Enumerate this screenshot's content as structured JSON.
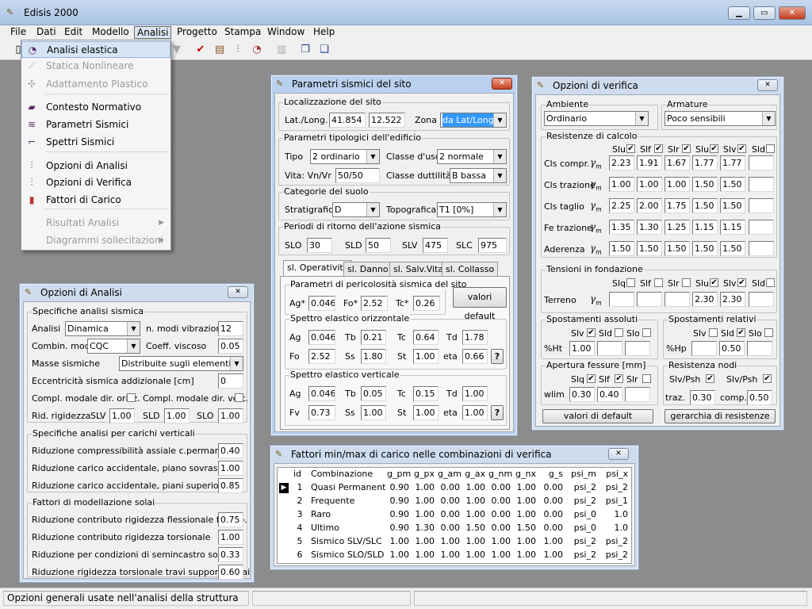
{
  "app": {
    "title": "Edisis 2000",
    "icon": "app-logo-icon"
  },
  "menubar": [
    "File",
    "Dati",
    "Edit",
    "Modello",
    "Analisi",
    "Progetto",
    "Stampa",
    "Window",
    "Help"
  ],
  "analisi_menu": {
    "items": [
      {
        "label": "Analisi elastica",
        "icon": "alarm-clock-icon",
        "disabled": false,
        "highlight": true
      },
      {
        "label": "Statica Nonlineare",
        "icon": "nonlinear-curve-icon",
        "disabled": true
      },
      {
        "label": "Adattamento Plastico",
        "icon": "plastic-icon",
        "disabled": true
      },
      {
        "label": "Contesto Normativo",
        "icon": "book-icon",
        "disabled": false
      },
      {
        "label": "Parametri Sismici",
        "icon": "seismograph-icon",
        "disabled": false
      },
      {
        "label": "Spettri Sismici",
        "icon": "spectrum-icon",
        "disabled": false
      },
      {
        "label": "Opzioni di Analisi",
        "icon": "options-icon",
        "disabled": false
      },
      {
        "label": "Opzioni di Verifica",
        "icon": "options-icon",
        "disabled": false
      },
      {
        "label": "Fattori di Carico",
        "icon": "bar-chart-icon",
        "disabled": false
      },
      {
        "label": "Risultati Analisi",
        "icon": "",
        "disabled": true,
        "submenu": true
      },
      {
        "label": "Diagrammi sollecitazioni",
        "icon": "",
        "disabled": true,
        "submenu": true
      }
    ]
  },
  "param_sismici": {
    "title": "Parametri sismici del sito",
    "loc": {
      "legend": "Localizzazione del sito",
      "latlong_label": "Lat./Long.",
      "lat": "41.854",
      "long": "12.522",
      "zona_label": "Zona",
      "zona": "da Lat/Long"
    },
    "tip": {
      "legend": "Parametri tipologici dell'edificio",
      "tipo_label": "Tipo",
      "tipo": "2 ordinario",
      "classe_uso_label": "Classe d'uso",
      "classe_uso": "2 normale",
      "vita_label": "Vita: Vn/Vr",
      "vita": "50/50",
      "classe_dutt_label": "Classe duttilità",
      "classe_dutt": "B bassa"
    },
    "suolo": {
      "legend": "Categorie del suolo",
      "strat_label": "Stratigrafica",
      "strat": "D",
      "topo_label": "Topografica",
      "topo": "T1  [0%]"
    },
    "periodi": {
      "legend": "Periodi di ritorno dell'azione sismica",
      "slo_label": "SLO",
      "slo": "30",
      "sld_label": "SLD",
      "sld": "50",
      "slv_label": "SLV",
      "slv": "475",
      "slc_label": "SLC",
      "slc": "975"
    },
    "tabs": [
      "sl. Operatività",
      "sl. Danno",
      "sl. Salv.Vita",
      "sl. Collasso"
    ],
    "peric": {
      "legend": "Parametri di pericolosità sismica del sito",
      "ag_label": "Ag*",
      "ag": "0.046",
      "fo_label": "Fo*",
      "fo": "2.52",
      "tc_label": "Tc*",
      "tc": "0.26",
      "default_btn": "valori default"
    },
    "orizz": {
      "legend": "Spettro elastico orizzontale",
      "ag": "0.046",
      "tb": "0.21",
      "tc": "0.64",
      "td": "1.78",
      "fo": "2.52",
      "ss": "1.80",
      "st": "1.00",
      "eta": "0.66"
    },
    "vert": {
      "legend": "Spettro elastico verticale",
      "ag": "0.046",
      "tb": "0.05",
      "tc": "0.15",
      "td": "1.00",
      "fv": "0.73",
      "ss": "1.00",
      "st": "1.00",
      "eta": "1.00"
    },
    "labels": {
      "ag": "Ag",
      "tb": "Tb",
      "tc": "Tc",
      "td": "Td",
      "fo": "Fo",
      "fv": "Fv",
      "ss": "Ss",
      "st": "St",
      "eta": "eta",
      "help": "?"
    }
  },
  "opz_verifica": {
    "title": "Opzioni di verifica",
    "ambiente_legend": "Ambiente",
    "ambiente": "Ordinario",
    "armature_legend": "Armature",
    "armature": "Poco sensibili",
    "resistenze_legend": "Resistenze di calcolo",
    "cols": [
      {
        "label": "Slu",
        "checked": true
      },
      {
        "label": "Slf",
        "checked": true
      },
      {
        "label": "Slr",
        "checked": true
      },
      {
        "label": "Slu",
        "checked": true
      },
      {
        "label": "Slv",
        "checked": true
      },
      {
        "label": "Sld",
        "checked": false
      }
    ],
    "gamma": "γ",
    "gamma_sub": "m",
    "rows": [
      {
        "label": "Cls compr.",
        "values": [
          "2.23",
          "1.91",
          "1.67",
          "1.77",
          "1.77",
          ""
        ]
      },
      {
        "label": "Cls trazione",
        "values": [
          "1.00",
          "1.00",
          "1.00",
          "1.50",
          "1.50",
          ""
        ]
      },
      {
        "label": "Cls taglio",
        "values": [
          "2.25",
          "2.00",
          "1.75",
          "1.50",
          "1.50",
          ""
        ]
      },
      {
        "label": "Fe trazione",
        "values": [
          "1.35",
          "1.30",
          "1.25",
          "1.15",
          "1.15",
          ""
        ]
      },
      {
        "label": "Aderenza",
        "values": [
          "1.50",
          "1.50",
          "1.50",
          "1.50",
          "1.50",
          ""
        ]
      }
    ],
    "tensioni_legend": "Tensioni in fondazione",
    "tens_cols": [
      {
        "label": "Slq",
        "checked": false
      },
      {
        "label": "Slf",
        "checked": false
      },
      {
        "label": "Slr",
        "checked": false
      },
      {
        "label": "Slu",
        "checked": true
      },
      {
        "label": "Slv",
        "checked": true
      },
      {
        "label": "Sld",
        "checked": false
      }
    ],
    "terreno_label": "Terreno",
    "terreno_values": [
      "",
      "",
      "",
      "2.30",
      "2.30",
      ""
    ],
    "spost_ass_legend": "Spostamenti assoluti",
    "spost_ass_cols": [
      {
        "label": "Slv",
        "checked": true
      },
      {
        "label": "Sld",
        "checked": false
      },
      {
        "label": "Slo",
        "checked": false
      }
    ],
    "ht_label": "%Ht",
    "ht_values": [
      "1.00",
      "",
      ""
    ],
    "spost_rel_legend": "Spostamenti relativi",
    "spost_rel_cols": [
      {
        "label": "Slv",
        "checked": false
      },
      {
        "label": "Sld",
        "checked": true
      },
      {
        "label": "Slo",
        "checked": false
      }
    ],
    "hp_label": "%Hp",
    "hp_values": [
      "",
      "0.50",
      ""
    ],
    "fessure_legend": "Apertura fessure [mm]",
    "fess_cols": [
      {
        "label": "Slq",
        "checked": true
      },
      {
        "label": "Slf",
        "checked": true
      },
      {
        "label": "Slr",
        "checked": false
      }
    ],
    "wlim_label": "wlim",
    "wlim_values": [
      "0.30",
      "0.40",
      ""
    ],
    "nodi_legend": "Resistenza nodi",
    "nodi_cols": [
      {
        "label": "Slv/Psh",
        "checked": true
      },
      {
        "label": "Slv/Psh",
        "checked": true
      }
    ],
    "traz_label": "traz.",
    "traz": "0.30",
    "comp_label": "comp.",
    "comp": "0.50",
    "btn_default": "valori di default",
    "btn_gerarchia": "gerarchia di resistenze"
  },
  "opz_analisi": {
    "title": "Opzioni di Analisi",
    "sismica_legend": "Specifiche analisi sismica",
    "analisi_label": "Analisi",
    "analisi": "Dinamica",
    "nmodi_label": "n. modi vibrazione",
    "nmodi": "12",
    "combin_label": "Combin. modi",
    "combin": "CQC",
    "viscoso_label": "Coeff. viscoso",
    "viscoso": "0.05",
    "masse_label": "Masse sismiche",
    "masse": "Distribuite sugli elementi",
    "eccentr_label": "Eccentricità sismica addizionale [cm]",
    "eccentr": "0",
    "compl_orizz_label": "Compl. modale dir. orizz.",
    "compl_vert_label": "Compl. modale dir. vert.",
    "rid_label": "Rid. rigidezza",
    "slv_label": "SLV",
    "slv": "1.00",
    "sld_label": "SLD",
    "sld": "1.00",
    "slo_label": "SLO",
    "slo": "1.00",
    "verticali_legend": "Specifiche analisi per carichi verticali",
    "vert_rows": [
      {
        "label": "Riduzione compressibilità assiale c.permanente",
        "value": "0.40"
      },
      {
        "label": "Riduzione carico accidentale, piano sovrastante",
        "value": "1.00"
      },
      {
        "label": "Riduzione carico accidentale, piani superiori",
        "value": "0.85"
      }
    ],
    "solai_legend": "Fattori di modellazione solai",
    "solai_rows": [
      {
        "label": "Riduzione contributo rigidezza flessionale fuori p.",
        "value": "0.75"
      },
      {
        "label": "Riduzione contributo rigidezza torsionale",
        "value": "1.00"
      },
      {
        "label": "Riduzione per condizioni di semincastro solai",
        "value": "0.33"
      },
      {
        "label": "Riduzione rigidezza torsionale travi supporto solai",
        "value": "0.60"
      }
    ]
  },
  "fattori": {
    "title": "Fattori min/max di carico nelle combinazioni di verifica",
    "headers": [
      "id",
      "Combinazione",
      "g_pm",
      "g_px",
      "g_am",
      "g_ax",
      "g_nm",
      "g_nx",
      "g_s",
      "psi_m",
      "psi_x"
    ],
    "rows": [
      [
        "1",
        "Quasi Permanente",
        "0.90",
        "1.00",
        "0.00",
        "1.00",
        "0.00",
        "1.00",
        "0.00",
        "psi_2",
        "psi_2"
      ],
      [
        "2",
        "Frequente",
        "0.90",
        "1.00",
        "0.00",
        "1.00",
        "0.00",
        "1.00",
        "0.00",
        "psi_2",
        "psi_1"
      ],
      [
        "3",
        "Raro",
        "0.90",
        "1.00",
        "0.00",
        "1.00",
        "0.00",
        "1.00",
        "0.00",
        "psi_0",
        "1.0"
      ],
      [
        "4",
        "Ultimo",
        "0.90",
        "1.30",
        "0.00",
        "1.50",
        "0.00",
        "1.50",
        "0.00",
        "psi_0",
        "1.0"
      ],
      [
        "5",
        "Sismico SLV/SLC",
        "1.00",
        "1.00",
        "1.00",
        "1.00",
        "1.00",
        "1.00",
        "1.00",
        "psi_2",
        "psi_2"
      ],
      [
        "6",
        "Sismico SLO/SLD",
        "1.00",
        "1.00",
        "1.00",
        "1.00",
        "1.00",
        "1.00",
        "1.00",
        "psi_2",
        "psi_2"
      ]
    ]
  },
  "status": {
    "text": "Opzioni generali usate nell'analisi della struttura"
  }
}
